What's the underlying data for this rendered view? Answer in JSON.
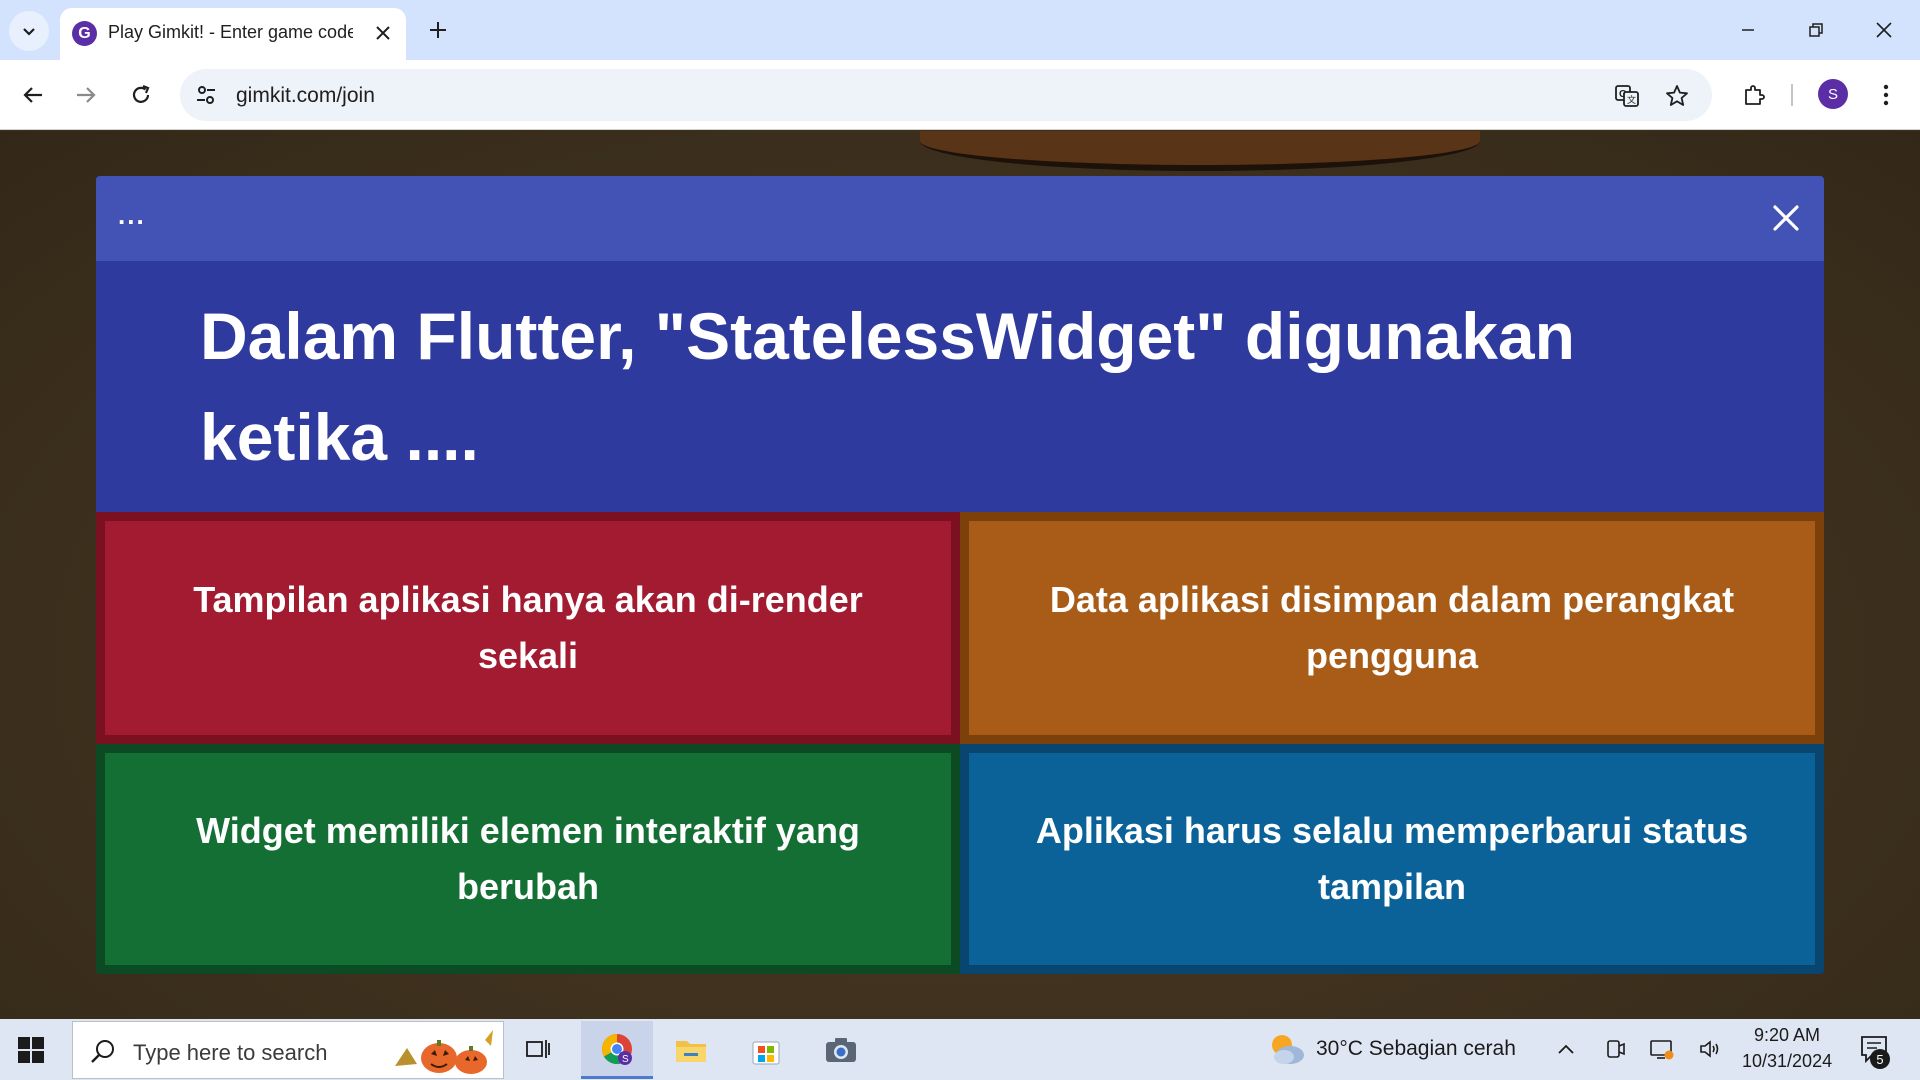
{
  "browser": {
    "tab_title": "Play Gimkit! - Enter game code",
    "favicon_letter": "G",
    "url": "gimkit.com/join",
    "profile_initial": "S"
  },
  "card": {
    "more_label": "...",
    "question": "Dalam Flutter, \"StatelessWidget\" digunakan ketika ....",
    "answers": [
      {
        "text": "Tampilan aplikasi hanya akan di-render sekali",
        "color": "#a31b30",
        "border": "#7a1020"
      },
      {
        "text": "Data aplikasi disimpan dalam perangkat pengguna",
        "color": "#a85c17",
        "border": "#7c400a"
      },
      {
        "text": "Widget memiliki elemen interaktif yang berubah",
        "color": "#136f34",
        "border": "#0b4a22"
      },
      {
        "text": "Aplikasi harus selalu memperbarui status tampilan",
        "color": "#0b6299",
        "border": "#084670"
      }
    ]
  },
  "taskbar": {
    "search_placeholder": "Type here to search",
    "weather": "30°C  Sebagian cerah",
    "time": "9:20 AM",
    "date": "10/31/2024",
    "notification_count": "5"
  }
}
